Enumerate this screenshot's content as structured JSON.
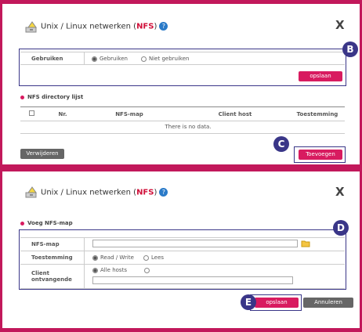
{
  "dialog1": {
    "title_prefix": "Unix / Linux netwerken (",
    "title_nfs": "NFS",
    "title_suffix": ")",
    "close": "X",
    "use_label": "Gebruiken",
    "use_on": "Gebruiken",
    "use_off": "Niet gebruiken",
    "save_button": "opslaan",
    "list_title": "NFS directory lijst",
    "columns": [
      "Nr.",
      "NFS-map",
      "Client host",
      "Toestemming"
    ],
    "empty": "There is no data.",
    "delete_button": "Verwijderen",
    "add_button": "Toevoegen"
  },
  "dialog2": {
    "title_prefix": "Unix / Linux netwerken (",
    "title_nfs": "NFS",
    "title_suffix": ")",
    "close": "X",
    "section_title": "Voeg NFS-map",
    "nfs_map_label": "NFS-map",
    "permission_label": "Toestemming",
    "perm_rw": "Read / Write",
    "perm_read": "Lees",
    "client_label_1": "Client",
    "client_label_2": "ontvangende",
    "all_hosts": "Alle hosts",
    "save_button": "opslaan",
    "cancel_button": "Annuleren"
  },
  "callouts": {
    "b": "B",
    "c": "C",
    "d": "D",
    "e": "E"
  },
  "colors": {
    "accent": "#d81b60",
    "callout": "#3a3688",
    "frame": "#c2185b"
  }
}
